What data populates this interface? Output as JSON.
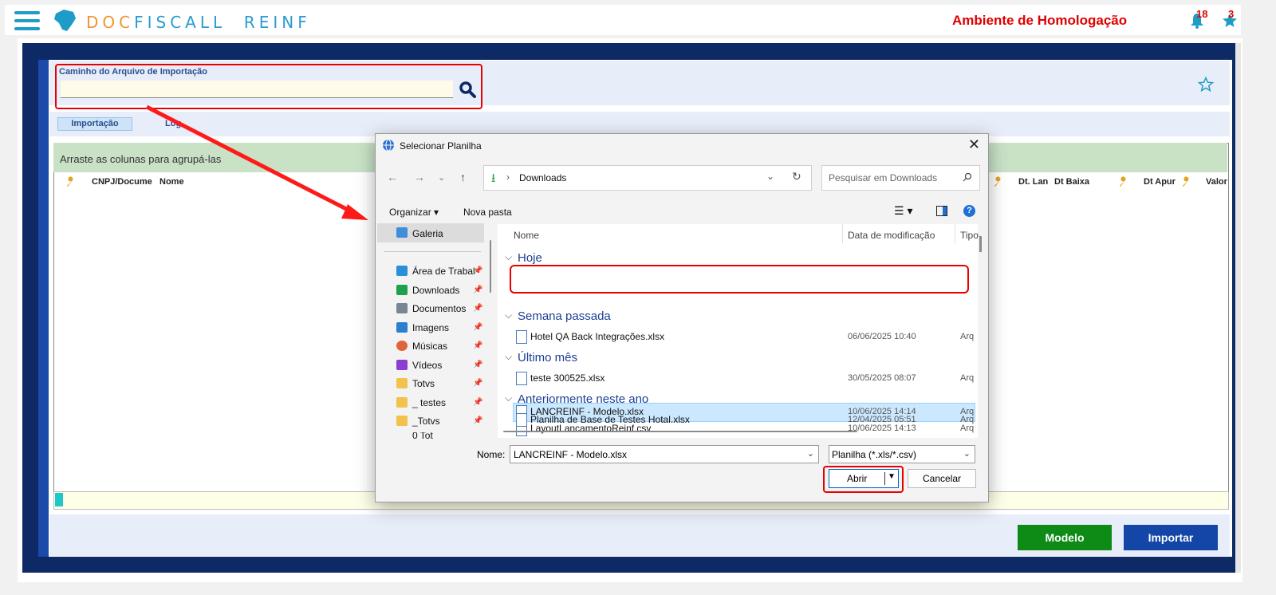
{
  "header": {
    "brand_prefix": "DOC",
    "brand_rest": "FISCALL",
    "brand_suffix": "REINF",
    "environment": "Ambiente de Homologação",
    "notifications_count": "18",
    "favorites_count": "3"
  },
  "import_form": {
    "path_label": "Caminho do Arquivo de Importação",
    "path_value": "",
    "tabs": [
      {
        "label": "Importação"
      },
      {
        "label": "Log"
      }
    ]
  },
  "grid": {
    "group_hint": "Arraste as colunas para agrupá-las",
    "columns": [
      "CNPJ/Docume",
      "Nome",
      "Dt. Lan",
      "Dt Baixa",
      "Dt Apur",
      "Valor"
    ]
  },
  "buttons": {
    "modelo": "Modelo",
    "importar": "Importar"
  },
  "dialog": {
    "title": "Selecionar Planilha",
    "address": "Downloads",
    "search_placeholder": "Pesquisar em Downloads",
    "organize": "Organizar",
    "new_folder": "Nova pasta",
    "sidebar": [
      {
        "label": "Galeria"
      },
      {
        "label": "Área de Trabal"
      },
      {
        "label": "Downloads"
      },
      {
        "label": "Documentos"
      },
      {
        "label": "Imagens"
      },
      {
        "label": "Músicas"
      },
      {
        "label": "Vídeos"
      },
      {
        "label": "Totvs"
      },
      {
        "label": "_ testes"
      },
      {
        "label": "_Totvs"
      },
      {
        "label": "0 Tot"
      }
    ],
    "columns": {
      "name": "Nome",
      "modified": "Data de modificação",
      "type": "Tipo"
    },
    "groups": [
      {
        "label": "Hoje"
      },
      {
        "label": "Semana passada"
      },
      {
        "label": "Último mês"
      },
      {
        "label": "Anteriormente neste ano"
      }
    ],
    "files": [
      {
        "name": "LANCREINF - Modelo.xlsx",
        "modified": "10/06/2025 14:14",
        "type": "Arq"
      },
      {
        "name": "LayoutLancamentoReinf.csv",
        "modified": "10/06/2025 14:13",
        "type": "Arq"
      },
      {
        "name": "Hotel QA Back Integrações.xlsx",
        "modified": "06/06/2025 10:40",
        "type": "Arq"
      },
      {
        "name": "teste 300525.xlsx",
        "modified": "30/05/2025 08:07",
        "type": "Arq"
      },
      {
        "name": "Planilha de Base de Testes Hotal.xlsx",
        "modified": "12/04/2025 05:51",
        "type": "Arq"
      }
    ],
    "name_label": "Nome:",
    "name_value": "LANCREINF - Modelo.xlsx",
    "filter_value": "Planilha (*.xls/*.csv)",
    "open_button": "Abrir",
    "cancel_button": "Cancelar"
  },
  "colors": {
    "accent_blue": "#1446a8",
    "green_button": "#0e8a16",
    "alert_red": "#e10000",
    "highlight_red": "#e80000"
  }
}
